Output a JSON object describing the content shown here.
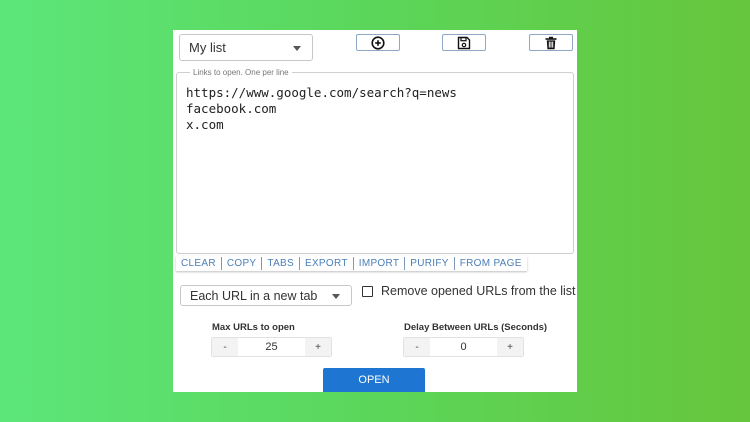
{
  "list_select": {
    "value": "My list"
  },
  "toolbar": {
    "add_icon": "plus-circle-icon",
    "save_icon": "floppy-disk-icon",
    "delete_icon": "trash-icon"
  },
  "links": {
    "legend": "Links to open. One per line",
    "text": "https://www.google.com/search?q=news\nfacebook.com\nx.com"
  },
  "actions": [
    "CLEAR",
    "COPY",
    "TABS",
    "EXPORT",
    "IMPORT",
    "PURIFY",
    "FROM PAGE"
  ],
  "mode_select": {
    "value": "Each URL in a new tab"
  },
  "remove_opened": {
    "label": "Remove opened URLs from the list",
    "checked": false
  },
  "max_urls": {
    "label": "Max URLs to open",
    "value": "25",
    "minus": "-",
    "plus": "+"
  },
  "delay": {
    "label": "Delay Between URLs (Seconds)",
    "value": "0",
    "minus": "-",
    "plus": "+"
  },
  "open_button": {
    "label": "OPEN"
  },
  "colors": {
    "accent": "#1e76d2",
    "link": "#4a7eb8"
  }
}
